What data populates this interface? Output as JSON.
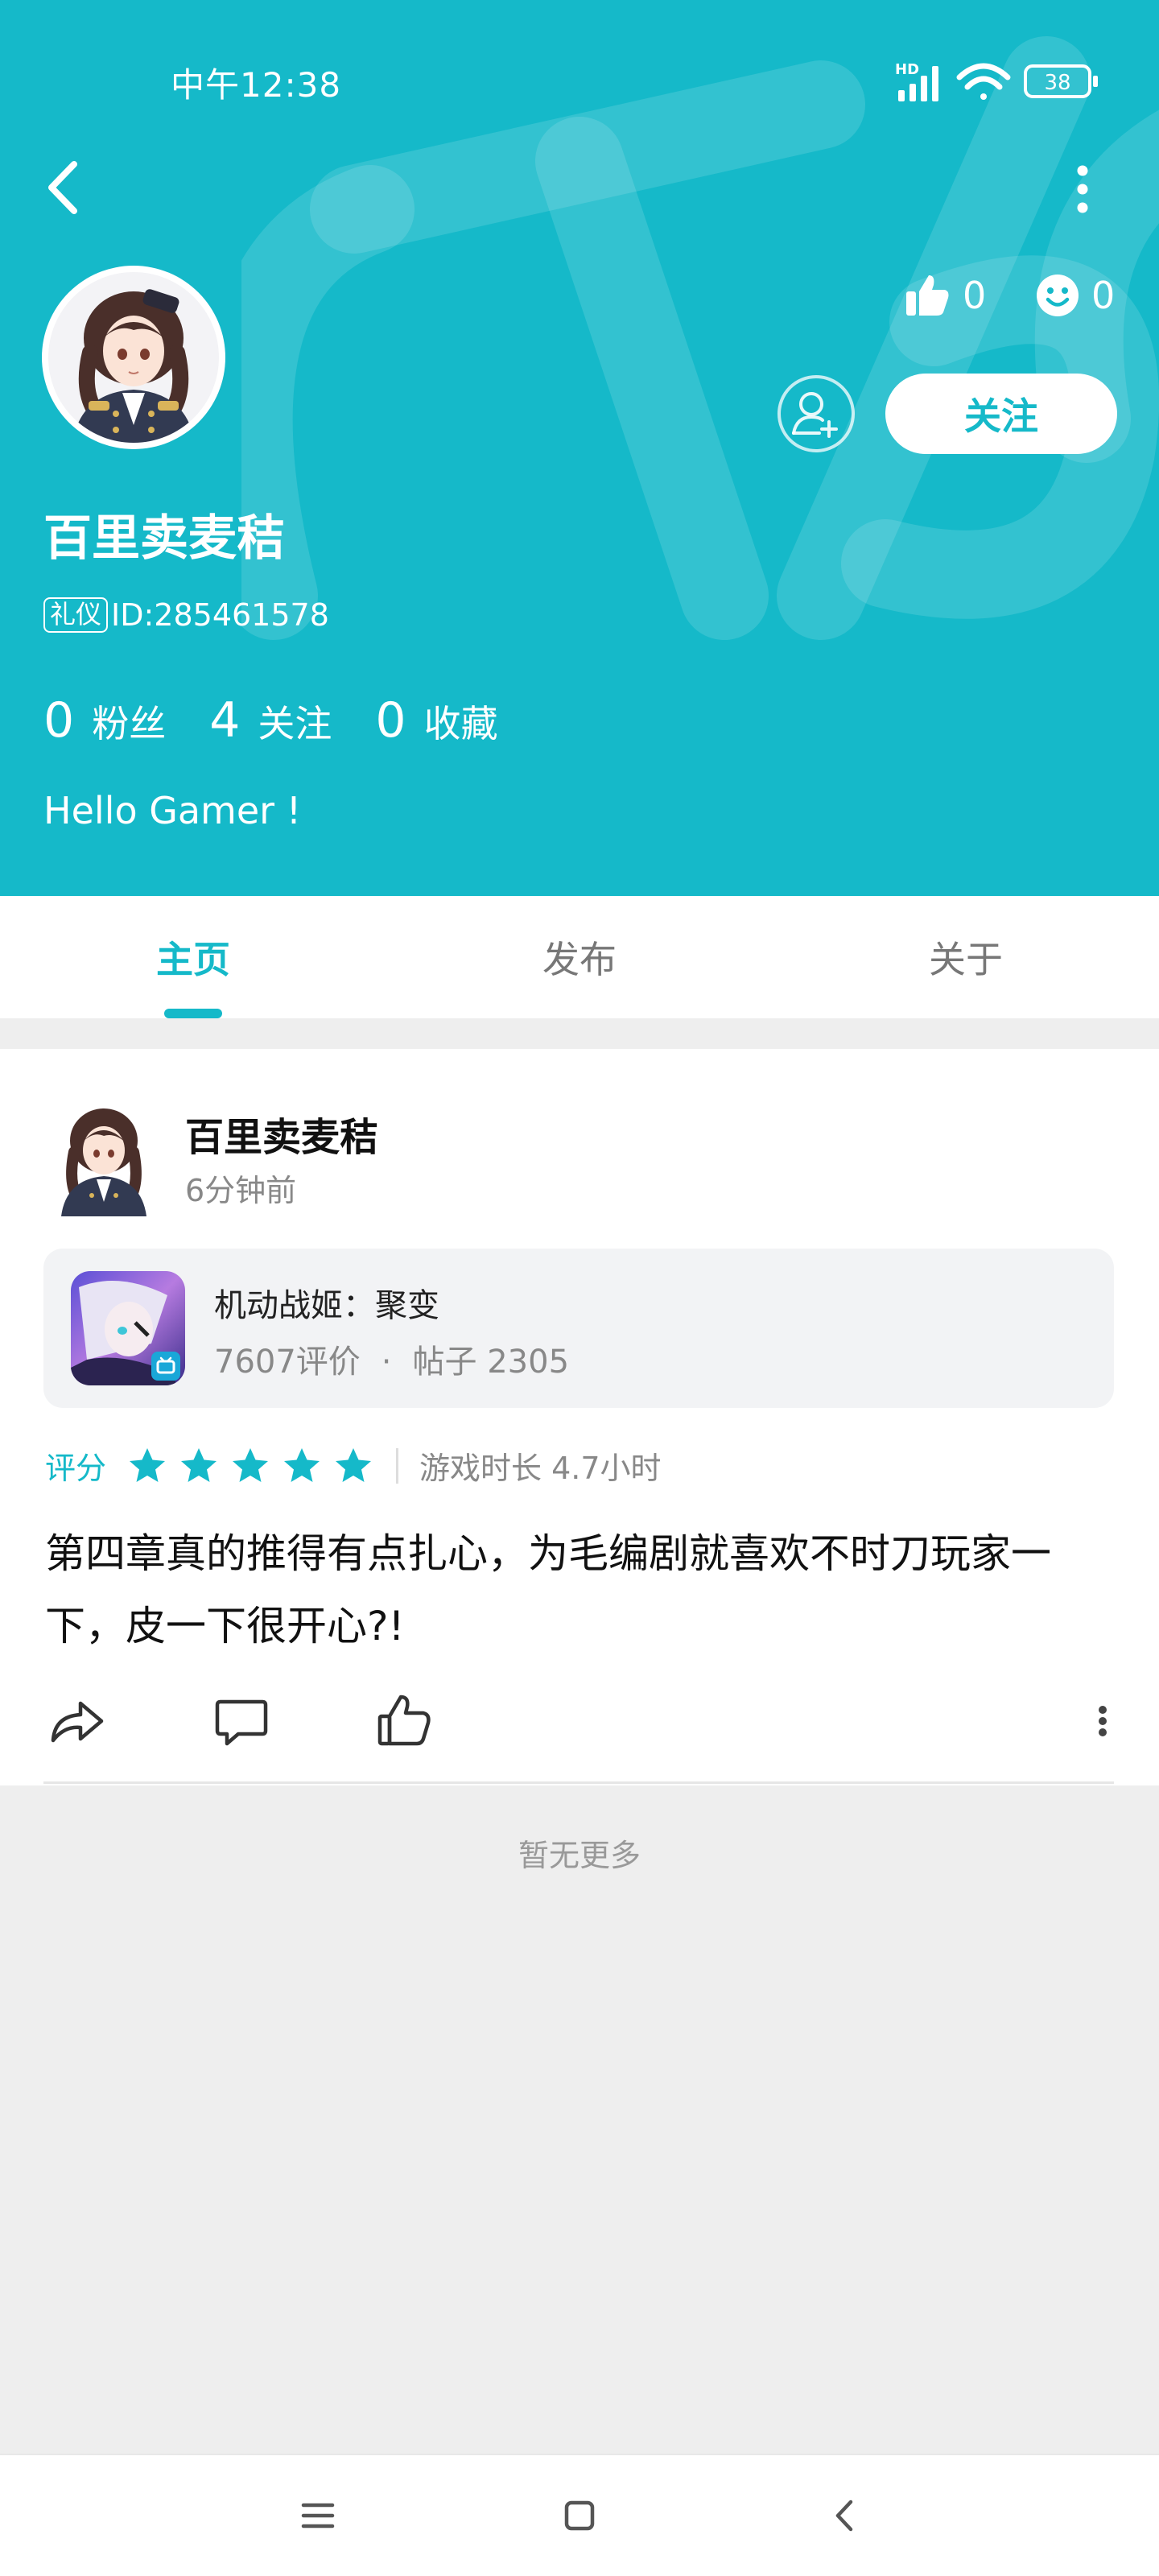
{
  "status_bar": {
    "time": "中午12:38",
    "battery": "38",
    "network_label": "HD"
  },
  "profile": {
    "username": "百里卖麦秸",
    "id_tag": "礼仪",
    "id_text": "ID:285461578",
    "likes": "0",
    "smiles": "0",
    "follow_label": "关注",
    "fans_count": "0",
    "fans_label": "粉丝",
    "following_count": "4",
    "following_label": "关注",
    "favorites_count": "0",
    "favorites_label": "收藏",
    "bio": "Hello Gamer !"
  },
  "tabs": [
    {
      "label": "主页",
      "active": true
    },
    {
      "label": "发布",
      "active": false
    },
    {
      "label": "关于",
      "active": false
    }
  ],
  "post": {
    "author": "百里卖麦秸",
    "time": "6分钟前",
    "game": {
      "name": "机动战姬：聚变",
      "reviews": "7607评价",
      "separator": "·",
      "posts": "帖子 2305"
    },
    "rating_label": "评分",
    "rating": 5,
    "playtime": "游戏时长 4.7小时",
    "text": "第四章真的推得有点扎心，为毛编剧就喜欢不时刀玩家一下，皮一下很开心?!"
  },
  "footer": {
    "no_more": "暂无更多"
  },
  "colors": {
    "accent": "#15b9c9",
    "background": "#eeeeee",
    "card": "#f2f3f5"
  },
  "icons": {
    "back": "chevron-left-icon",
    "more": "vertical-dots-icon",
    "like": "thumbs-up-icon",
    "smile": "smile-icon",
    "add_friend": "add-user-icon",
    "share": "share-icon",
    "comment": "comment-icon",
    "star": "star-icon"
  }
}
